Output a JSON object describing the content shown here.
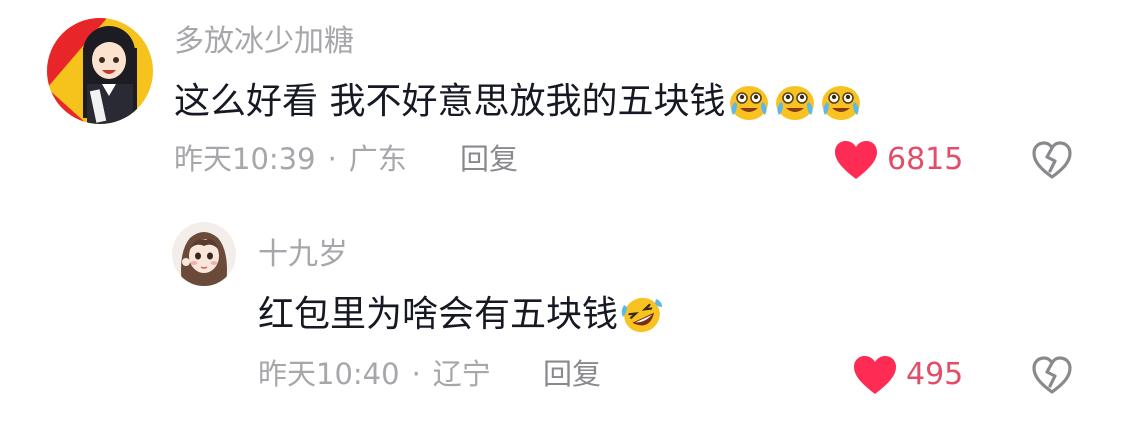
{
  "comment": {
    "username": "多放冰少加糖",
    "text": "这么好看 我不好意思放我的五块钱",
    "emojis": [
      "crying-laughing-face",
      "crying-laughing-face",
      "crying-laughing-face"
    ],
    "time": "昨天10:39",
    "separator": "·",
    "location": "广东",
    "reply_label": "回复",
    "likes": "6815",
    "avatar_colors": [
      "#e8262a",
      "#f7c21d"
    ]
  },
  "reply": {
    "username": "十九岁",
    "text": "红包里为啥会有五块钱",
    "emojis": [
      "rolling-laughing-face"
    ],
    "time": "昨天10:40",
    "separator": "·",
    "location": "辽宁",
    "reply_label": "回复",
    "likes": "495"
  },
  "colors": {
    "like": "#fe2c55",
    "like_count": "#e44d67",
    "meta": "#a7a7ab",
    "text": "#161823",
    "emoji": "#f8c322"
  }
}
